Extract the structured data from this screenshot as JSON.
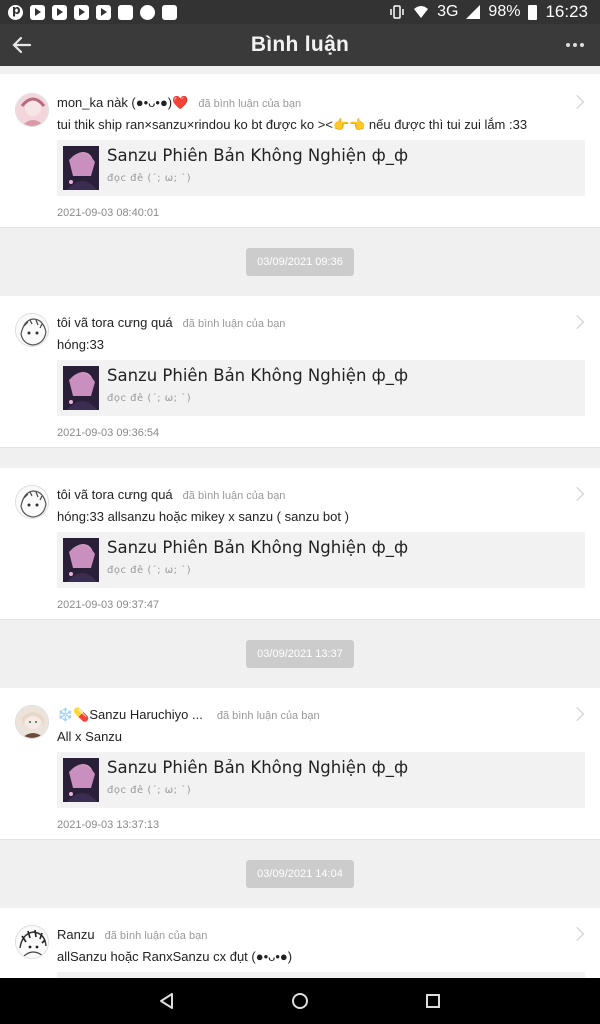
{
  "status_bar": {
    "battery": "98%",
    "network": "3G",
    "time": "16:23"
  },
  "app_bar": {
    "title": "Bình luận"
  },
  "comments": [
    {
      "user": "mon_ka nàk (●•ᴗ•●)❤️",
      "action": "đã bình luận của bạn",
      "text": "tui thik ship ran×sanzu×rindou ko bt được ko ><👉👈 nếu được thì tui zui lắm :33",
      "quote_title": "Sanzu Phiên Bản Không Nghiện ф_ф",
      "quote_sub": "đọc đê (´; ω; `)",
      "time": "2021-09-03 08:40:01"
    },
    {
      "user": "tôi vã tora cưng quá",
      "action": "đã bình luận của bạn",
      "text": "hóng:33",
      "quote_title": "Sanzu Phiên Bản Không Nghiện ф_ф",
      "quote_sub": "đọc đê (´; ω; `)",
      "time": "2021-09-03 09:36:54"
    },
    {
      "user": "tôi vã tora cưng quá",
      "action": "đã bình luận của bạn",
      "text": "hóng:33 allsanzu hoặc mikey x sanzu ( sanzu bot )",
      "quote_title": "Sanzu Phiên Bản Không Nghiện ф_ф",
      "quote_sub": "đọc đê (´; ω; `)",
      "time": "2021-09-03 09:37:47"
    },
    {
      "user": "❄️💊Sanzu Haruchiyo ...",
      "action": "đã bình luận của bạn",
      "text": "All x Sanzu",
      "quote_title": "Sanzu Phiên Bản Không Nghiện ф_ф",
      "quote_sub": "đọc đê (´; ω; `)",
      "time": "2021-09-03 13:37:13"
    },
    {
      "user": "Ranzu",
      "action": "đã bình luận của bạn",
      "text": "allSanzu hoặc RanxSanzu cx đụt (●•ᴗ•●)"
    }
  ],
  "dividers": [
    "03/09/2021 09:36",
    "03/09/2021 13:37",
    "03/09/2021 14:04"
  ]
}
